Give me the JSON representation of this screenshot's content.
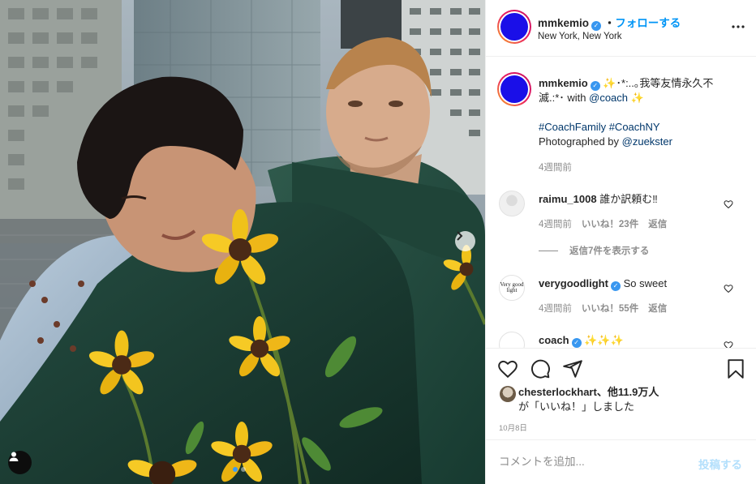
{
  "post": {
    "alt": "Two men in green leather jackets among yellow flowers in front of skyscrapers",
    "carousel_count": 2,
    "carousel_active": 1
  },
  "header": {
    "username": "mmkemio",
    "follow_label": "フォローする",
    "separator": "・",
    "location": "New York, New York",
    "more_icon": "ellipsis-icon"
  },
  "caption": {
    "username": "mmkemio",
    "text_1": "✨･*:..｡我等友情永久不滅.:*･ with ",
    "mention_coach": "@coach",
    "sparkle": "✨",
    "hashtags": "#CoachFamily #CoachNY",
    "photo_credit_prefix": "Photographed by ",
    "photo_credit_handle": "@zuekster",
    "time": "4週間前"
  },
  "comments": [
    {
      "username": "raimu_1008",
      "text": "誰か訳頼む‼",
      "time": "4週間前",
      "likes": "いいね！23件",
      "reply": "返信",
      "view_replies": "返信7件を表示する",
      "verified": false
    },
    {
      "username": "verygoodlight",
      "text": "So sweet",
      "time": "4週間前",
      "likes": "いいね！55件",
      "reply": "返信",
      "verified": true,
      "avatar_text": "Very good light"
    },
    {
      "username": "coach",
      "text": "✨✨✨",
      "verified": true
    }
  ],
  "actions": {
    "like_icon": "heart-icon",
    "comment_icon": "comment-icon",
    "share_icon": "send-icon",
    "save_icon": "bookmark-icon",
    "liked_by_user": "chesterlockhart",
    "liked_by_others": "、他11.9万人",
    "liked_suffix": "が「いいね！」しました",
    "date": "10月8日"
  },
  "add_comment": {
    "placeholder": "コメントを追加...",
    "post_label": "投稿する"
  },
  "colors": {
    "accent": "#0095f6",
    "avatar_blue": "#1a0fe8",
    "verified": "#3897f0",
    "muted": "#8e8e8e"
  }
}
